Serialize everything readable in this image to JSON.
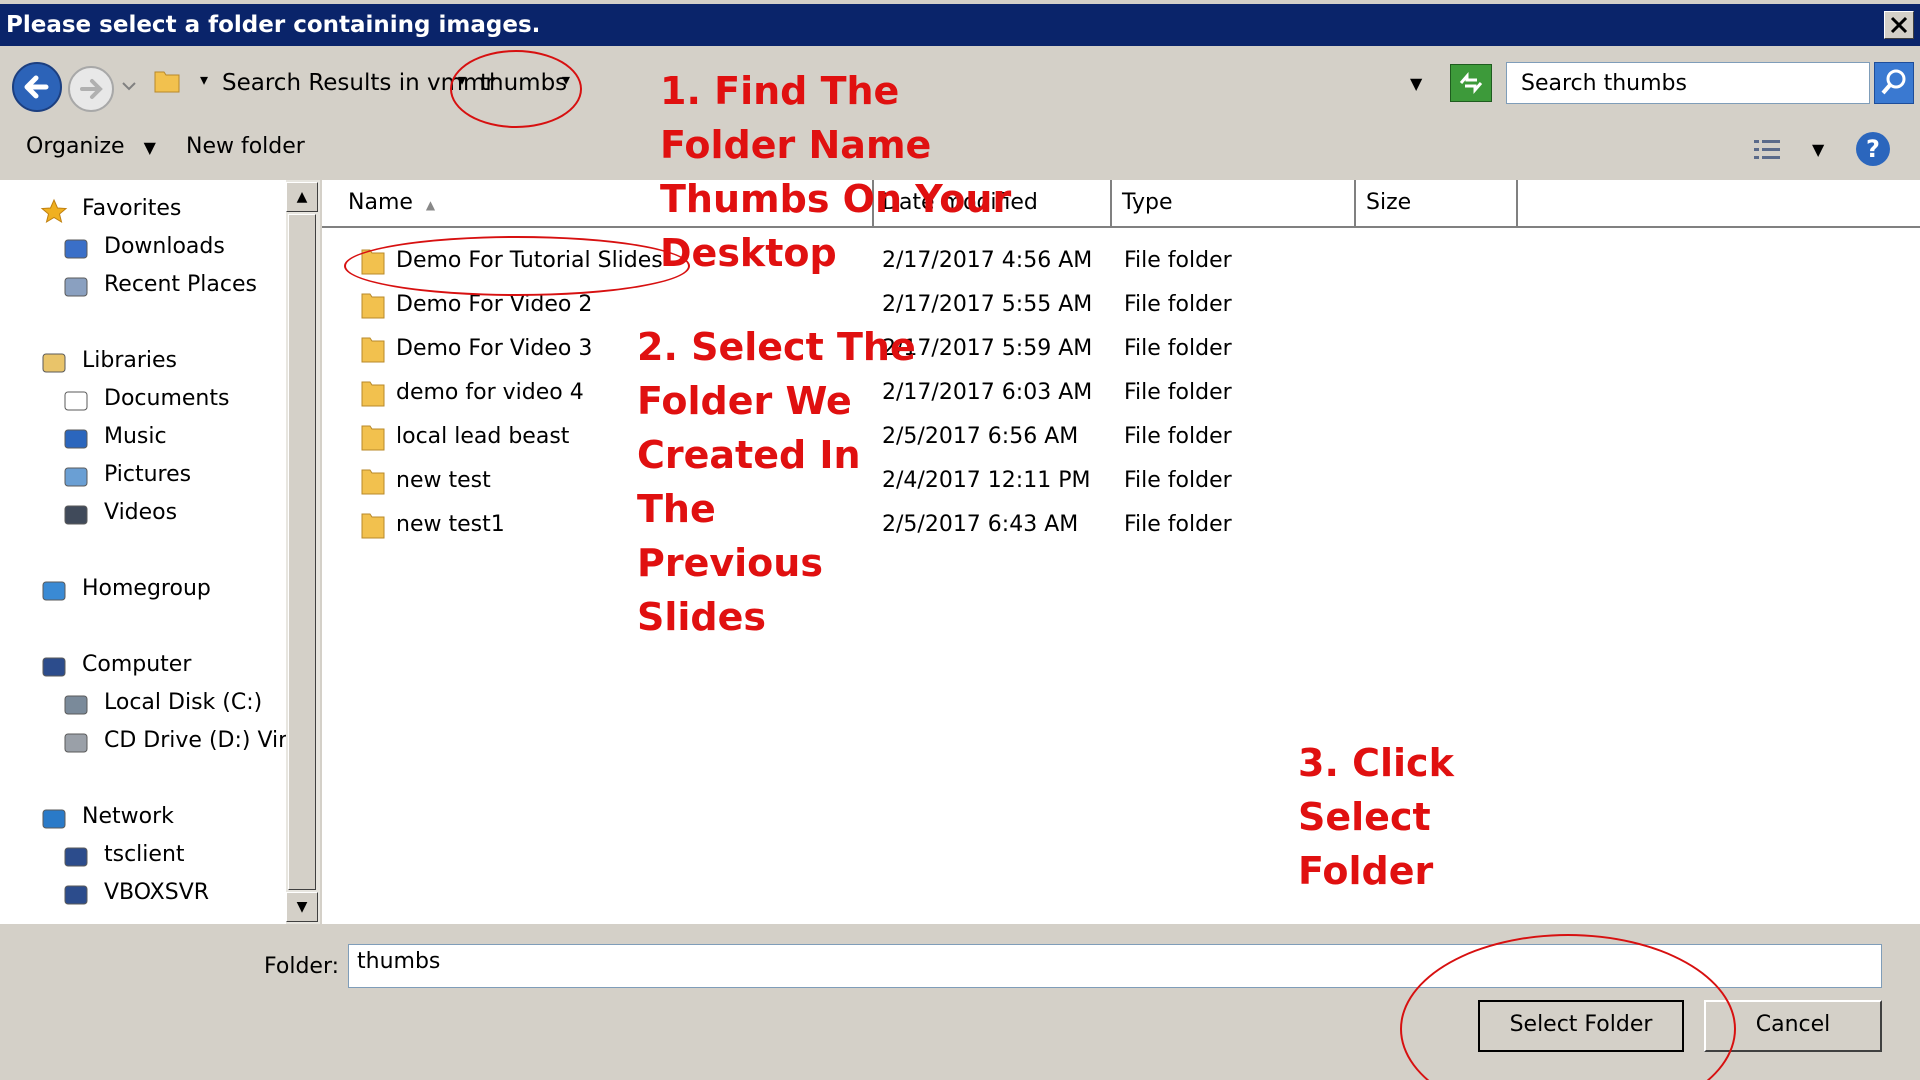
{
  "window": {
    "title": "Please select a folder containing images.",
    "close_label": "✕"
  },
  "address": {
    "crumbs": [
      "Search Results in vmmr",
      "thumbs"
    ],
    "search_placeholder": "Search thumbs"
  },
  "toolbar": {
    "organize_label": "Organize",
    "new_folder_label": "New folder"
  },
  "nav": {
    "items": [
      {
        "label": "Favorites",
        "icon": "star-icon"
      },
      {
        "label": "Downloads",
        "icon": "downloads-folder-icon"
      },
      {
        "label": "Recent Places",
        "icon": "recent-places-icon"
      },
      {
        "label": "Libraries",
        "icon": "libraries-icon"
      },
      {
        "label": "Documents",
        "icon": "document-icon"
      },
      {
        "label": "Music",
        "icon": "music-note-icon"
      },
      {
        "label": "Pictures",
        "icon": "pictures-icon"
      },
      {
        "label": "Videos",
        "icon": "video-film-icon"
      },
      {
        "label": "Homegroup",
        "icon": "homegroup-icon"
      },
      {
        "label": "Computer",
        "icon": "computer-icon"
      },
      {
        "label": "Local Disk (C:)",
        "icon": "local-disk-icon"
      },
      {
        "label": "CD Drive (D:) Virtu",
        "icon": "cd-drive-icon"
      },
      {
        "label": "Network",
        "icon": "network-icon"
      },
      {
        "label": "tsclient",
        "icon": "network-computer-icon"
      },
      {
        "label": "VBOXSVR",
        "icon": "network-computer-icon"
      }
    ]
  },
  "columns": {
    "name": "Name",
    "date": "Date modified",
    "type": "Type",
    "size": "Size"
  },
  "files": [
    {
      "name": "Demo For Tutorial Slides",
      "date": "2/17/2017 4:56 AM",
      "type": "File folder"
    },
    {
      "name": "Demo For Video 2",
      "date": "2/17/2017 5:55 AM",
      "type": "File folder"
    },
    {
      "name": "Demo For Video 3",
      "date": "2/17/2017 5:59 AM",
      "type": "File folder"
    },
    {
      "name": "demo for video 4",
      "date": "2/17/2017 6:03 AM",
      "type": "File folder"
    },
    {
      "name": "local lead beast",
      "date": "2/5/2017 6:56 AM",
      "type": "File folder"
    },
    {
      "name": "new test",
      "date": "2/4/2017 12:11 PM",
      "type": "File folder"
    },
    {
      "name": "new test1",
      "date": "2/5/2017 6:43 AM",
      "type": "File folder"
    }
  ],
  "footer": {
    "folder_label": "Folder:",
    "folder_value": "thumbs",
    "select_label": "Select Folder",
    "cancel_label": "Cancel"
  },
  "annotations": {
    "step1": "1. Find The\nFolder Name\nThumbs On Your\nDesktop",
    "step2": "2. Select The\nFolder We\nCreated In\nThe\nPrevious\nSlides",
    "step3": "3. Click\nSelect\nFolder"
  },
  "colors": {
    "title_bar": "#0a246a",
    "annotation_red": "#e01010",
    "dialog_gray": "#d4d0c8"
  }
}
